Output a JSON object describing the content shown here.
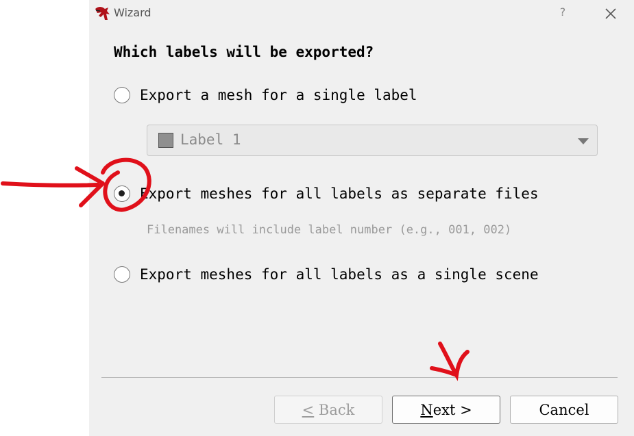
{
  "window": {
    "title": "Wizard",
    "help_label": "?",
    "close_icon": "close-icon",
    "app_icon": "app-logo-icon"
  },
  "page": {
    "heading": "Which labels will be exported?",
    "options": [
      {
        "label": "Export a mesh for a single label",
        "checked": false
      },
      {
        "label": "Export meshes for all labels as separate files",
        "checked": true
      },
      {
        "label": "Export meshes for all labels as a single scene",
        "checked": false
      }
    ],
    "label_combo": {
      "value": "Label 1",
      "swatch_color": "#8f8f8f",
      "enabled": false
    },
    "hint": "Filenames will include label number (e.g., 001, 002)"
  },
  "buttons": {
    "back": "< Back",
    "next": "Next >",
    "cancel": "Cancel"
  },
  "colors": {
    "dialog_bg": "#f0f0f0",
    "annotation": "#e0101a"
  }
}
